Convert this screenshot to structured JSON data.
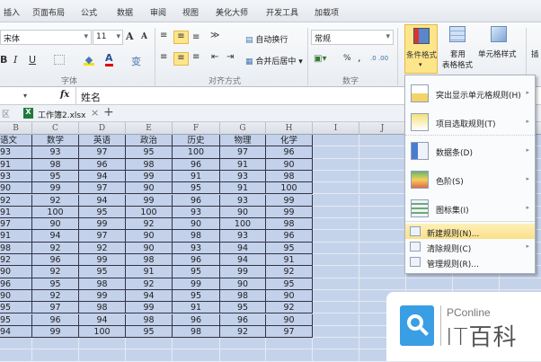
{
  "tabs": [
    "插入",
    "页面布局",
    "公式",
    "数据",
    "审阅",
    "视图",
    "美化大师",
    "开发工具",
    "加载项"
  ],
  "ribbon": {
    "font_name": "宋体",
    "font_size": "11",
    "grow": "A",
    "shrink": "A",
    "bold": "B",
    "italic": "I",
    "underline": "U",
    "font_color": "A",
    "phonetic": "变",
    "wrap_text": "自动换行",
    "merge_center": "合并后居中",
    "number_format": "常规",
    "percent": "%",
    "comma": ",",
    "cond_format": "条件格式",
    "table_format_1": "套用",
    "table_format_2": "表格格式",
    "cell_style": "单元格样式",
    "insert": "插",
    "groups": {
      "font": "字体",
      "align": "对齐方式",
      "number": "数字"
    }
  },
  "formula_bar": {
    "fx": "fx",
    "value": "姓名"
  },
  "workbook_tabs": {
    "left": "区",
    "file": "工作簿2.xlsx",
    "close": "×",
    "add": "+"
  },
  "columns": [
    "B",
    "C",
    "D",
    "E",
    "F",
    "G",
    "H",
    "I",
    "J"
  ],
  "table": {
    "headers": [
      "语文",
      "数学",
      "英语",
      "政治",
      "历史",
      "物理",
      "化学"
    ],
    "rows": [
      [
        93,
        93,
        97,
        95,
        100,
        97,
        96
      ],
      [
        91,
        98,
        96,
        98,
        96,
        91,
        90
      ],
      [
        93,
        95,
        94,
        99,
        91,
        93,
        98
      ],
      [
        90,
        99,
        97,
        90,
        95,
        91,
        100
      ],
      [
        92,
        92,
        94,
        99,
        96,
        93,
        99
      ],
      [
        91,
        100,
        95,
        100,
        93,
        90,
        99
      ],
      [
        97,
        90,
        99,
        92,
        90,
        100,
        98
      ],
      [
        91,
        94,
        97,
        90,
        98,
        93,
        96
      ],
      [
        98,
        92,
        92,
        90,
        93,
        94,
        95
      ],
      [
        92,
        96,
        99,
        98,
        96,
        94,
        91
      ],
      [
        90,
        92,
        95,
        91,
        95,
        99,
        92
      ],
      [
        96,
        95,
        98,
        92,
        99,
        90,
        95
      ],
      [
        90,
        92,
        99,
        94,
        95,
        98,
        90
      ],
      [
        95,
        97,
        98,
        99,
        91,
        95,
        92
      ],
      [
        95,
        96,
        94,
        98,
        96,
        96,
        90
      ],
      [
        94,
        99,
        100,
        95,
        98,
        92,
        97
      ]
    ]
  },
  "menu": [
    {
      "label": "突出显示单元格规则(H)",
      "icon": "highlight-rules-icon",
      "sub": true
    },
    {
      "label": "项目选取规则(T)",
      "icon": "top-bottom-rules-icon",
      "sub": true
    },
    {
      "label": "数据条(D)",
      "icon": "data-bars-icon",
      "sub": true
    },
    {
      "label": "色阶(S)",
      "icon": "color-scales-icon",
      "sub": true
    },
    {
      "label": "图标集(I)",
      "icon": "icon-sets-icon",
      "sub": true
    },
    {
      "label": "新建规则(N)...",
      "icon": "new-rule-icon",
      "sub": false
    },
    {
      "label": "清除规则(C)",
      "icon": "clear-rules-icon",
      "sub": true
    },
    {
      "label": "管理规则(R)...",
      "icon": "manage-rules-icon",
      "sub": false
    }
  ],
  "submenu_arrow": "▸",
  "logo": {
    "brand": "PConline",
    "name": "IT百科"
  },
  "colors": {
    "highlight": "#fde58a",
    "selection": "#c3d1eb",
    "logo_blue": "#3a9ee4"
  }
}
